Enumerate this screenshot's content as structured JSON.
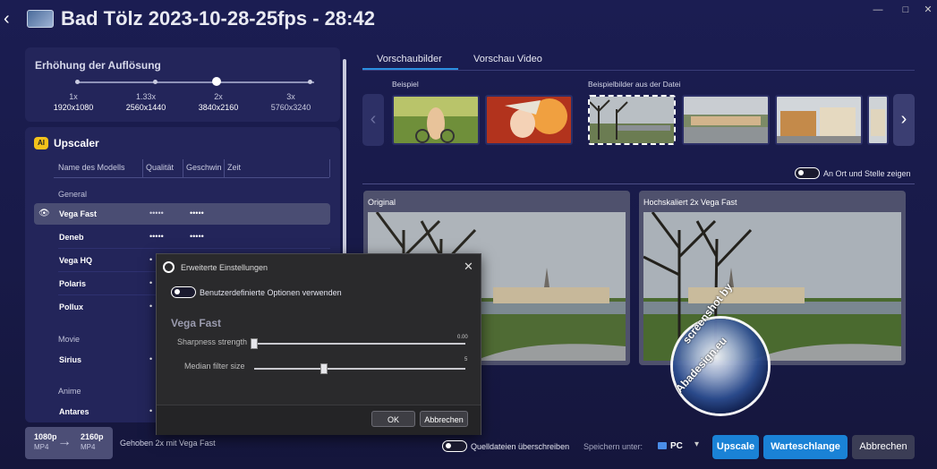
{
  "title": "Bad Tölz 2023-10-28-25fps - 28:42",
  "window_controls": {
    "minimize": "—",
    "maximize": "□",
    "close": "✕"
  },
  "resolution": {
    "heading": "Erhöhung der Auflösung",
    "scales": [
      {
        "factor": "1x",
        "res": "1920x1080"
      },
      {
        "factor": "1.33x",
        "res": "2560x1440"
      },
      {
        "factor": "2x",
        "res": "3840x2160"
      },
      {
        "factor": "3x",
        "res": "5760x3240"
      }
    ],
    "selected": "2x"
  },
  "upscaler": {
    "badge": "AI",
    "heading": "Upscaler",
    "columns": [
      "Name des Modells",
      "Qualität",
      "Geschwin",
      "Zeit"
    ],
    "groups": [
      "General",
      "Movie",
      "Anime"
    ],
    "models": [
      {
        "name": "Vega Fast",
        "quality": "•••••",
        "speed": "•••••",
        "selected": true
      },
      {
        "name": "Deneb",
        "quality": "•••••",
        "speed": "•••••"
      },
      {
        "name": "Vega HQ",
        "quality": "•"
      },
      {
        "name": "Polaris",
        "quality": "•"
      },
      {
        "name": "Pollux",
        "quality": "•"
      },
      {
        "name": "Sirius",
        "quality": "•"
      },
      {
        "name": "Antares",
        "quality": "•"
      }
    ]
  },
  "format": {
    "from_res": "1080p",
    "from_fmt": "MP4",
    "arrow": "→",
    "to_res": "2160p",
    "to_fmt": "MP4"
  },
  "status_text": "Gehoben 2x mit Vega Fast",
  "tabs": [
    "Vorschaubilder",
    "Vorschau Video"
  ],
  "preview": {
    "example_label": "Beispiel",
    "file_samples_label": "Beispielbilder aus der Datei",
    "prev_icon": "‹",
    "next_icon": "›",
    "toggle_label": "An Ort und Stelle zeigen",
    "original_label": "Original",
    "upscaled_label": "Hochskaliert 2x Vega Fast"
  },
  "dialog": {
    "title": "Erweiterte Einstellungen",
    "close": "✕",
    "custom_toggle_label": "Benutzerdefinierte Optionen verwenden",
    "model_heading": "Vega Fast",
    "sliders": [
      {
        "label": "Sharpness strength",
        "value": "0.00",
        "level": 0.0
      },
      {
        "label": "Median filter size",
        "value": "5",
        "level": 0.33
      }
    ],
    "ok": "OK",
    "cancel": "Abbrechen"
  },
  "footer": {
    "overwrite_label": "Quelldateien überschreiben",
    "save_label": "Speichern unter:",
    "target": "PC",
    "chevron": "▾",
    "upscale": "Upscale",
    "queue": "Warteschlange",
    "cancel": "Abbrechen"
  },
  "watermark": {
    "line1": "screenshot by",
    "line2": "Abadesign.eu"
  },
  "colors": {
    "accent": "#1a82d6",
    "background": "#1b1d52",
    "panel": "#23255a"
  }
}
